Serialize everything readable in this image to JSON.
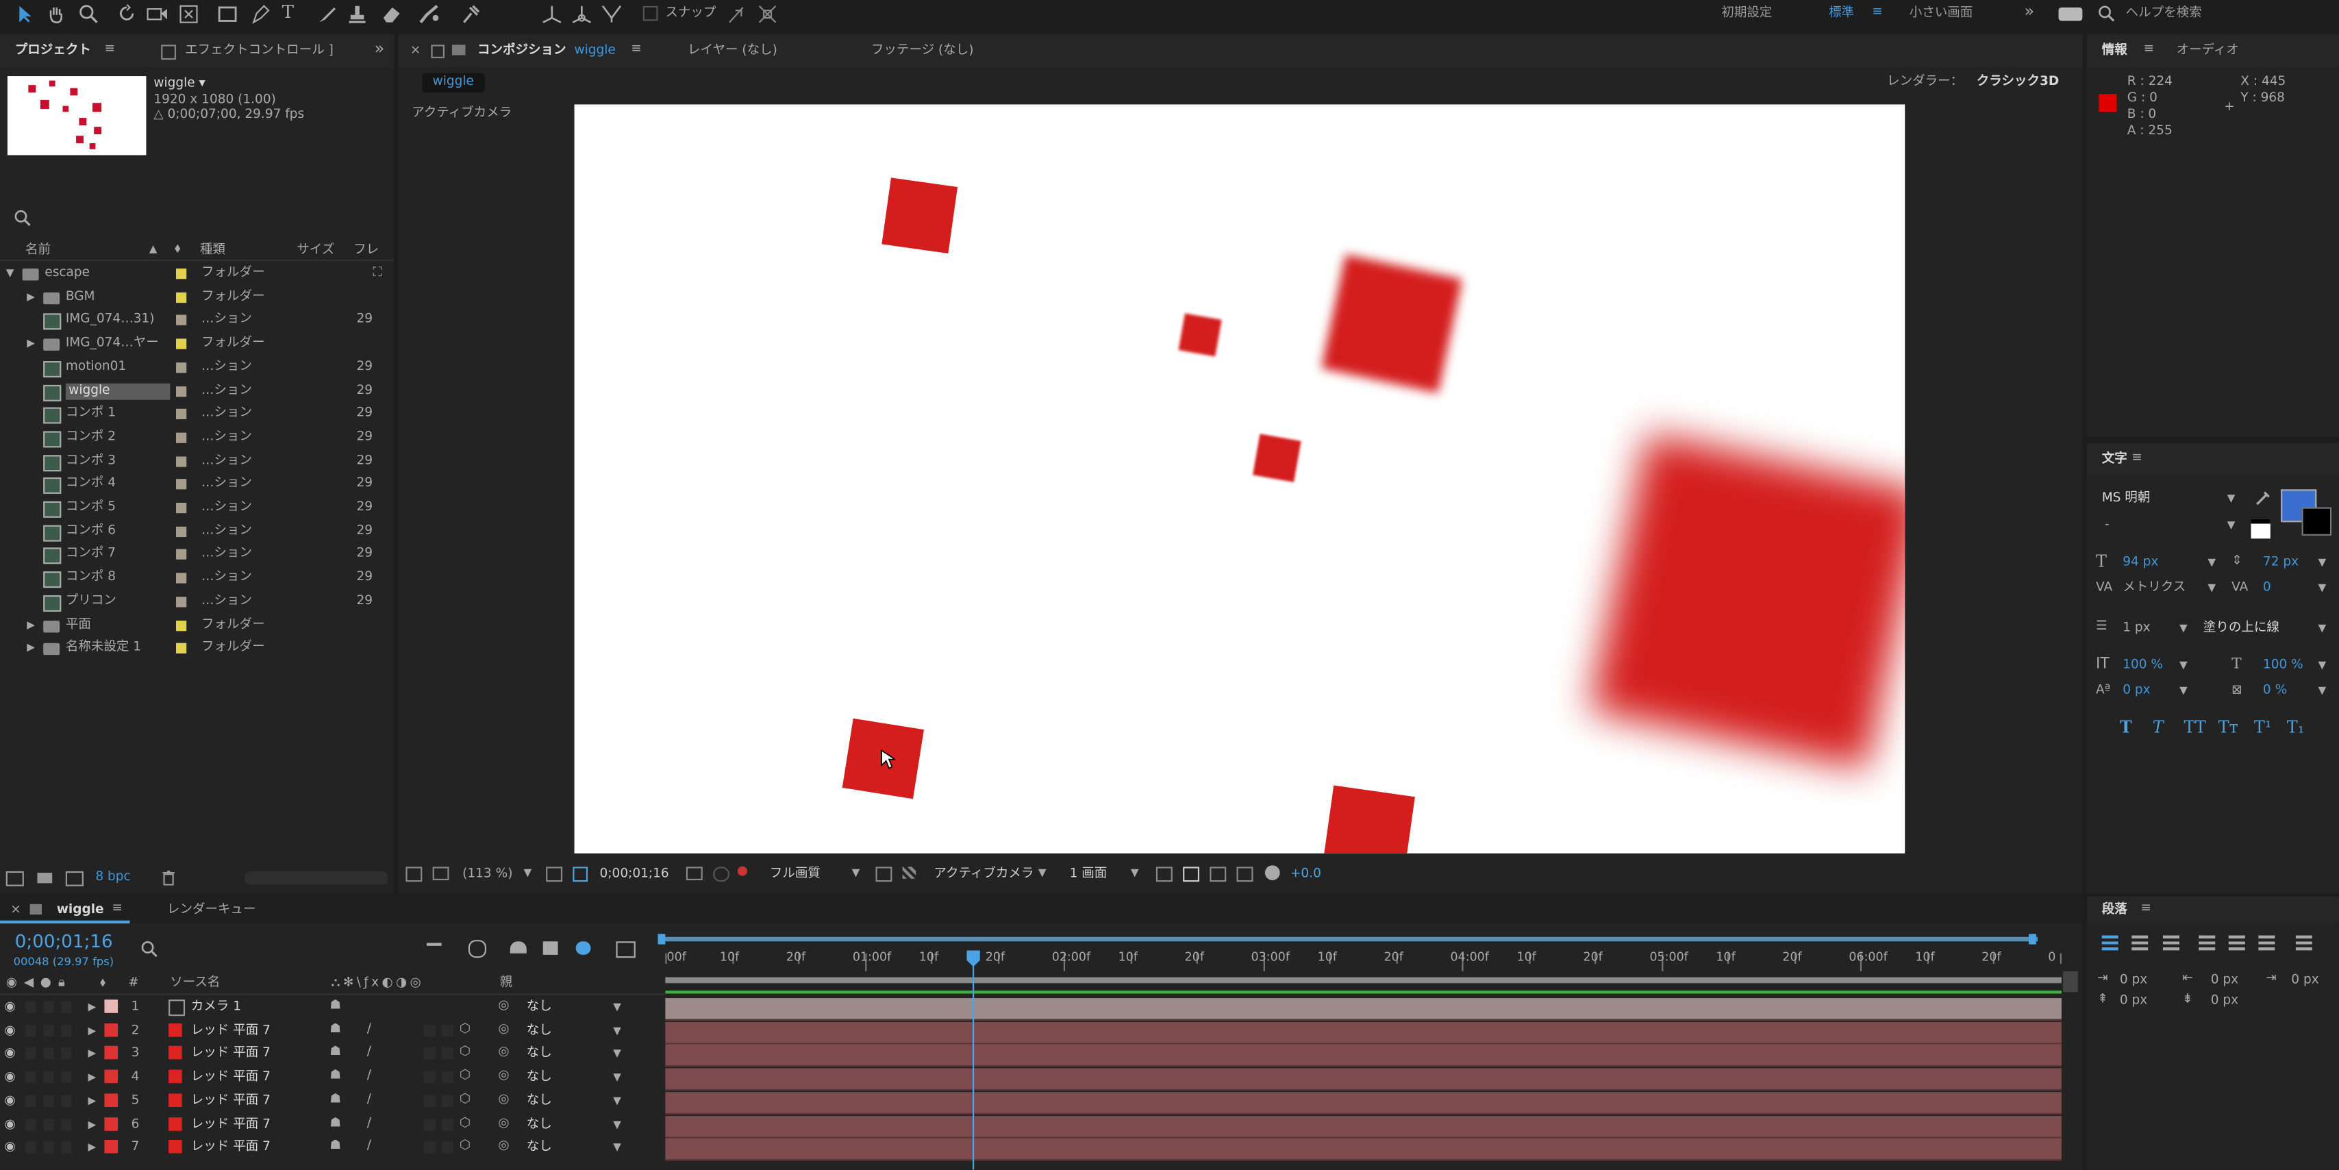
{
  "toolbar": {
    "snap_label": "スナップ",
    "workspaces": [
      "初期設定",
      "標準",
      "小さい画面"
    ],
    "active_workspace": "標準",
    "help_search": "ヘルプを検索"
  },
  "project_panel": {
    "tab_project": "プロジェクト",
    "tab_effect": "エフェクトコントロール ]",
    "comp_name": "wiggle ▾",
    "comp_size": "1920 x 1080 (1.00)",
    "comp_duration": "△ 0;00;07;00, 29.97 fps",
    "search_placeholder": "",
    "col_name": "名前",
    "col_type": "種類",
    "col_size": "サイズ",
    "col_frame": "フレ",
    "items": [
      {
        "name": "escape",
        "type": "フォルダー",
        "fr": "",
        "kind": "folder",
        "indent": 0,
        "open": true,
        "color": "#e2d24a"
      },
      {
        "name": "BGM",
        "type": "フォルダー",
        "fr": "",
        "kind": "folder",
        "indent": 1,
        "open": false,
        "color": "#e2d24a"
      },
      {
        "name": "IMG_074…31)",
        "type": "…ション",
        "fr": "29",
        "kind": "comp",
        "indent": 1,
        "color": "#a89c8b"
      },
      {
        "name": "IMG_074…ヤー",
        "type": "フォルダー",
        "fr": "",
        "kind": "folder",
        "indent": 1,
        "open": false,
        "color": "#e2d24a"
      },
      {
        "name": "motion01",
        "type": "…ション",
        "fr": "29",
        "kind": "comp",
        "indent": 1,
        "color": "#a89c8b"
      },
      {
        "name": "wiggle",
        "type": "…ション",
        "fr": "29",
        "kind": "comp",
        "indent": 1,
        "color": "#a89c8b",
        "selected": true
      },
      {
        "name": "コンポ 1",
        "type": "…ション",
        "fr": "29",
        "kind": "comp",
        "indent": 1,
        "color": "#a89c8b"
      },
      {
        "name": "コンポ 2",
        "type": "…ション",
        "fr": "29",
        "kind": "comp",
        "indent": 1,
        "color": "#a89c8b"
      },
      {
        "name": "コンポ 3",
        "type": "…ション",
        "fr": "29",
        "kind": "comp",
        "indent": 1,
        "color": "#a89c8b"
      },
      {
        "name": "コンポ 4",
        "type": "…ション",
        "fr": "29",
        "kind": "comp",
        "indent": 1,
        "color": "#a89c8b"
      },
      {
        "name": "コンポ 5",
        "type": "…ション",
        "fr": "29",
        "kind": "comp",
        "indent": 1,
        "color": "#a89c8b"
      },
      {
        "name": "コンポ 6",
        "type": "…ション",
        "fr": "29",
        "kind": "comp",
        "indent": 1,
        "color": "#a89c8b"
      },
      {
        "name": "コンポ 7",
        "type": "…ション",
        "fr": "29",
        "kind": "comp",
        "indent": 1,
        "color": "#a89c8b"
      },
      {
        "name": "コンポ 8",
        "type": "…ション",
        "fr": "29",
        "kind": "comp",
        "indent": 1,
        "color": "#a89c8b"
      },
      {
        "name": "プリコン",
        "type": "…ション",
        "fr": "29",
        "kind": "comp",
        "indent": 1,
        "color": "#a89c8b"
      },
      {
        "name": "平面",
        "type": "フォルダー",
        "fr": "",
        "kind": "folder",
        "indent": 1,
        "open": false,
        "color": "#e2d24a"
      },
      {
        "name": "名称未設定 1",
        "type": "フォルダー",
        "fr": "",
        "kind": "folder",
        "indent": 1,
        "open": false,
        "color": "#e2d24a"
      }
    ],
    "bpc": "8 bpc"
  },
  "comp_panel": {
    "tab_comp": "コンポジション",
    "tab_comp_name": "wiggle",
    "tab_layer": "レイヤー (なし)",
    "tab_footage": "フッテージ (なし)",
    "breadcrumb": "wiggle",
    "renderer_label": "レンダラー：",
    "renderer_value": "クラシック3D",
    "view_label": "アクティブカメラ",
    "zoom": "(113 %)",
    "timecode": "0;00;01;16",
    "quality": "フル画質",
    "camera": "アクティブカメラ",
    "views": "1 画面",
    "exposure": "+0.0"
  },
  "info_panel": {
    "tab_info": "情報",
    "tab_audio": "オーディオ",
    "r": "R : 224",
    "g": "G : 0",
    "b": "B : 0",
    "a": "A : 255",
    "x": "X : 445",
    "y": "Y : 968",
    "color": "#e00000"
  },
  "char_panel": {
    "title": "文字",
    "font": "MS 明朝",
    "style": "-",
    "size": "94 px",
    "leading": "72 px",
    "kerning": "メトリクス",
    "tracking": "0",
    "stroke": "1 px",
    "stroke_mode": "塗りの上に線",
    "vscale": "100 %",
    "hscale": "100 %",
    "baseline": "0 px",
    "tsume": "0 %",
    "fill_color": "#3a6fd0"
  },
  "para_panel": {
    "title": "段落",
    "indent_left": "0 px",
    "indent_first": "0 px",
    "indent_right": "0 px",
    "space_before": "0 px",
    "space_after": "0 px"
  },
  "timeline": {
    "tab_comp": "wiggle",
    "tab_render": "レンダーキュー",
    "timecode": "0;00;01;16",
    "frame_info": "00048 (29.97 fps)",
    "col_source": "ソース名",
    "col_parent": "親",
    "ruler": [
      "00f",
      "10f",
      "20f",
      "01:00f",
      "10f",
      "20f",
      "02:00f",
      "10f",
      "20f",
      "03:00f",
      "10f",
      "20f",
      "04:00f",
      "10f",
      "20f",
      "05:00f",
      "10f",
      "20f",
      "06:00f",
      "10f",
      "20f",
      "0"
    ],
    "layers": [
      {
        "num": "1",
        "name": "カメラ 1",
        "parent": "なし",
        "label_color": "#e8b7b7",
        "kind": "camera"
      },
      {
        "num": "2",
        "name": "レッド 平面 7",
        "parent": "なし",
        "label_color": "#d33",
        "kind": "solid"
      },
      {
        "num": "3",
        "name": "レッド 平面 7",
        "parent": "なし",
        "label_color": "#d33",
        "kind": "solid"
      },
      {
        "num": "4",
        "name": "レッド 平面 7",
        "parent": "なし",
        "label_color": "#d33",
        "kind": "solid"
      },
      {
        "num": "5",
        "name": "レッド 平面 7",
        "parent": "なし",
        "label_color": "#d33",
        "kind": "solid"
      },
      {
        "num": "6",
        "name": "レッド 平面 7",
        "parent": "なし",
        "label_color": "#d33",
        "kind": "solid"
      },
      {
        "num": "7",
        "name": "レッド 平面 7",
        "parent": "なし",
        "label_color": "#d33",
        "kind": "solid"
      }
    ],
    "playhead_label": "01:16f"
  }
}
